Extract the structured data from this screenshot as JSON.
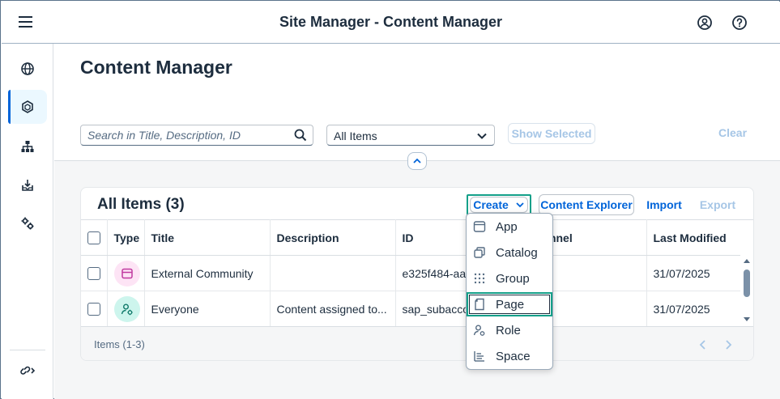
{
  "shell": {
    "title": "Site Manager - Content Manager"
  },
  "sidenav": {
    "items": [
      {
        "icon": "globe-icon"
      },
      {
        "icon": "content-icon",
        "active": true
      },
      {
        "icon": "sitemap-icon"
      },
      {
        "icon": "inbox-icon"
      },
      {
        "icon": "settings-icon"
      }
    ],
    "bottom_icon": "link-expand-icon"
  },
  "page": {
    "title": "Content Manager"
  },
  "filters": {
    "search_placeholder": "Search in Title, Description, ID",
    "select_value": "All Items",
    "show_selected_label": "Show Selected",
    "clear_label": "Clear"
  },
  "panel": {
    "title": "All Items (3)",
    "create_label": "Create",
    "content_explorer_label": "Content Explorer",
    "import_label": "Import",
    "export_label": "Export"
  },
  "table": {
    "columns": [
      "Type",
      "Title",
      "Description",
      "ID",
      "Channel",
      "Last Modified"
    ],
    "rows": [
      {
        "type_icon": "space-type-icon",
        "title": "External Community",
        "description": "",
        "id": "e325f484-aa",
        "channel": "l",
        "last_modified": "31/07/2025"
      },
      {
        "type_icon": "role-type-icon",
        "title": "Everyone",
        "description": "Content assigned to...",
        "id": "sap_subacco",
        "channel": "l",
        "last_modified": "31/07/2025"
      }
    ],
    "footer": "Items (1-3)"
  },
  "create_menu": {
    "items": [
      {
        "label": "App",
        "icon": "app-icon"
      },
      {
        "label": "Catalog",
        "icon": "catalog-icon"
      },
      {
        "label": "Group",
        "icon": "group-icon"
      },
      {
        "label": "Page",
        "icon": "page-icon"
      },
      {
        "label": "Role",
        "icon": "role-icon"
      },
      {
        "label": "Space",
        "icon": "space-icon"
      }
    ]
  },
  "colors": {
    "accent": "#0064d9",
    "highlight": "#14a089",
    "text": "#1d2d3e"
  }
}
